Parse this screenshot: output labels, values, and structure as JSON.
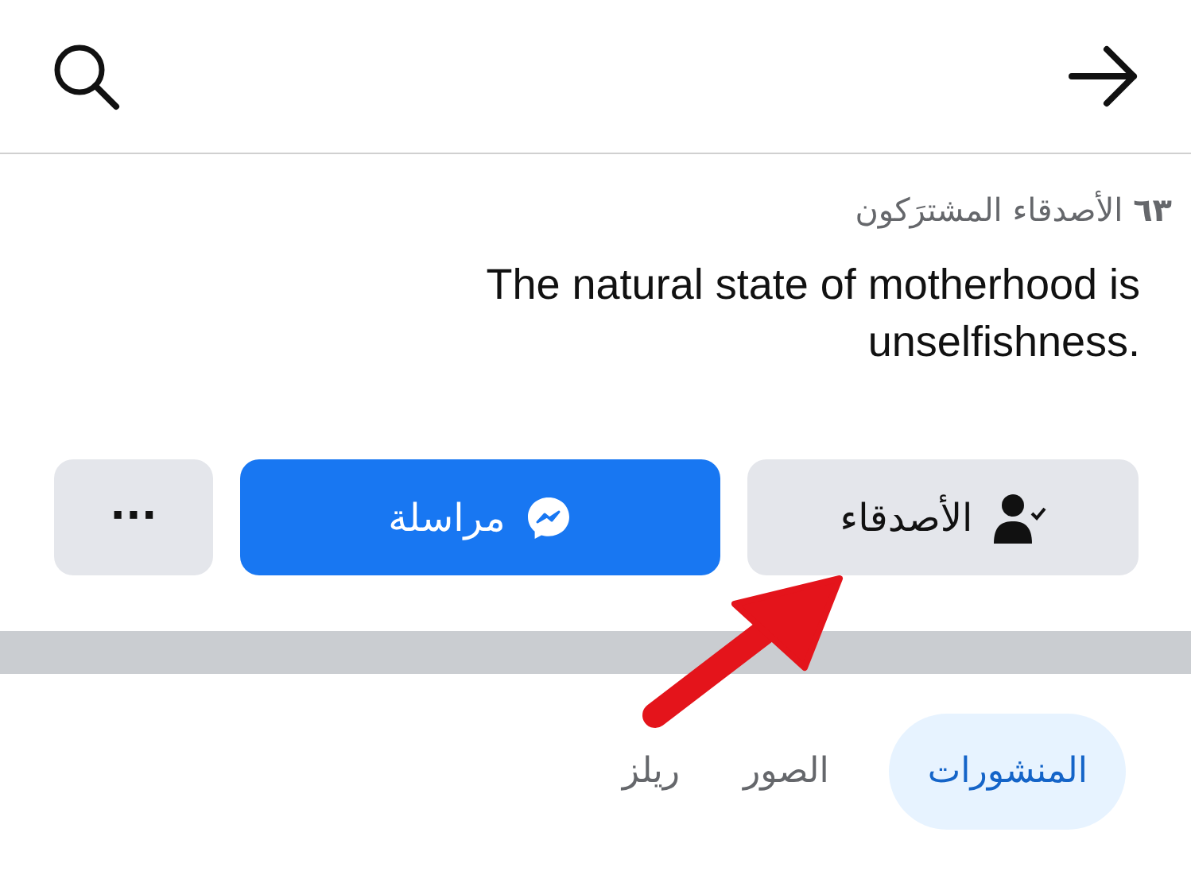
{
  "mutual_friends": "**٦٣** الأصدقاء المشترَكون",
  "bio": "The natural state of motherhood is unselfishness.",
  "actions": [
    {
      "kind": "friends",
      "label": "الأصدقاء"
    },
    {
      "kind": "message",
      "label": "مراسلة"
    },
    {
      "kind": "more",
      "label": "···"
    }
  ],
  "tabs": [
    {
      "label": "المنشورات",
      "selected": true
    },
    {
      "label": "الصور",
      "selected": false
    },
    {
      "label": "ريلز",
      "selected": false
    }
  ],
  "annotation": {
    "kind": "arrow"
  }
}
